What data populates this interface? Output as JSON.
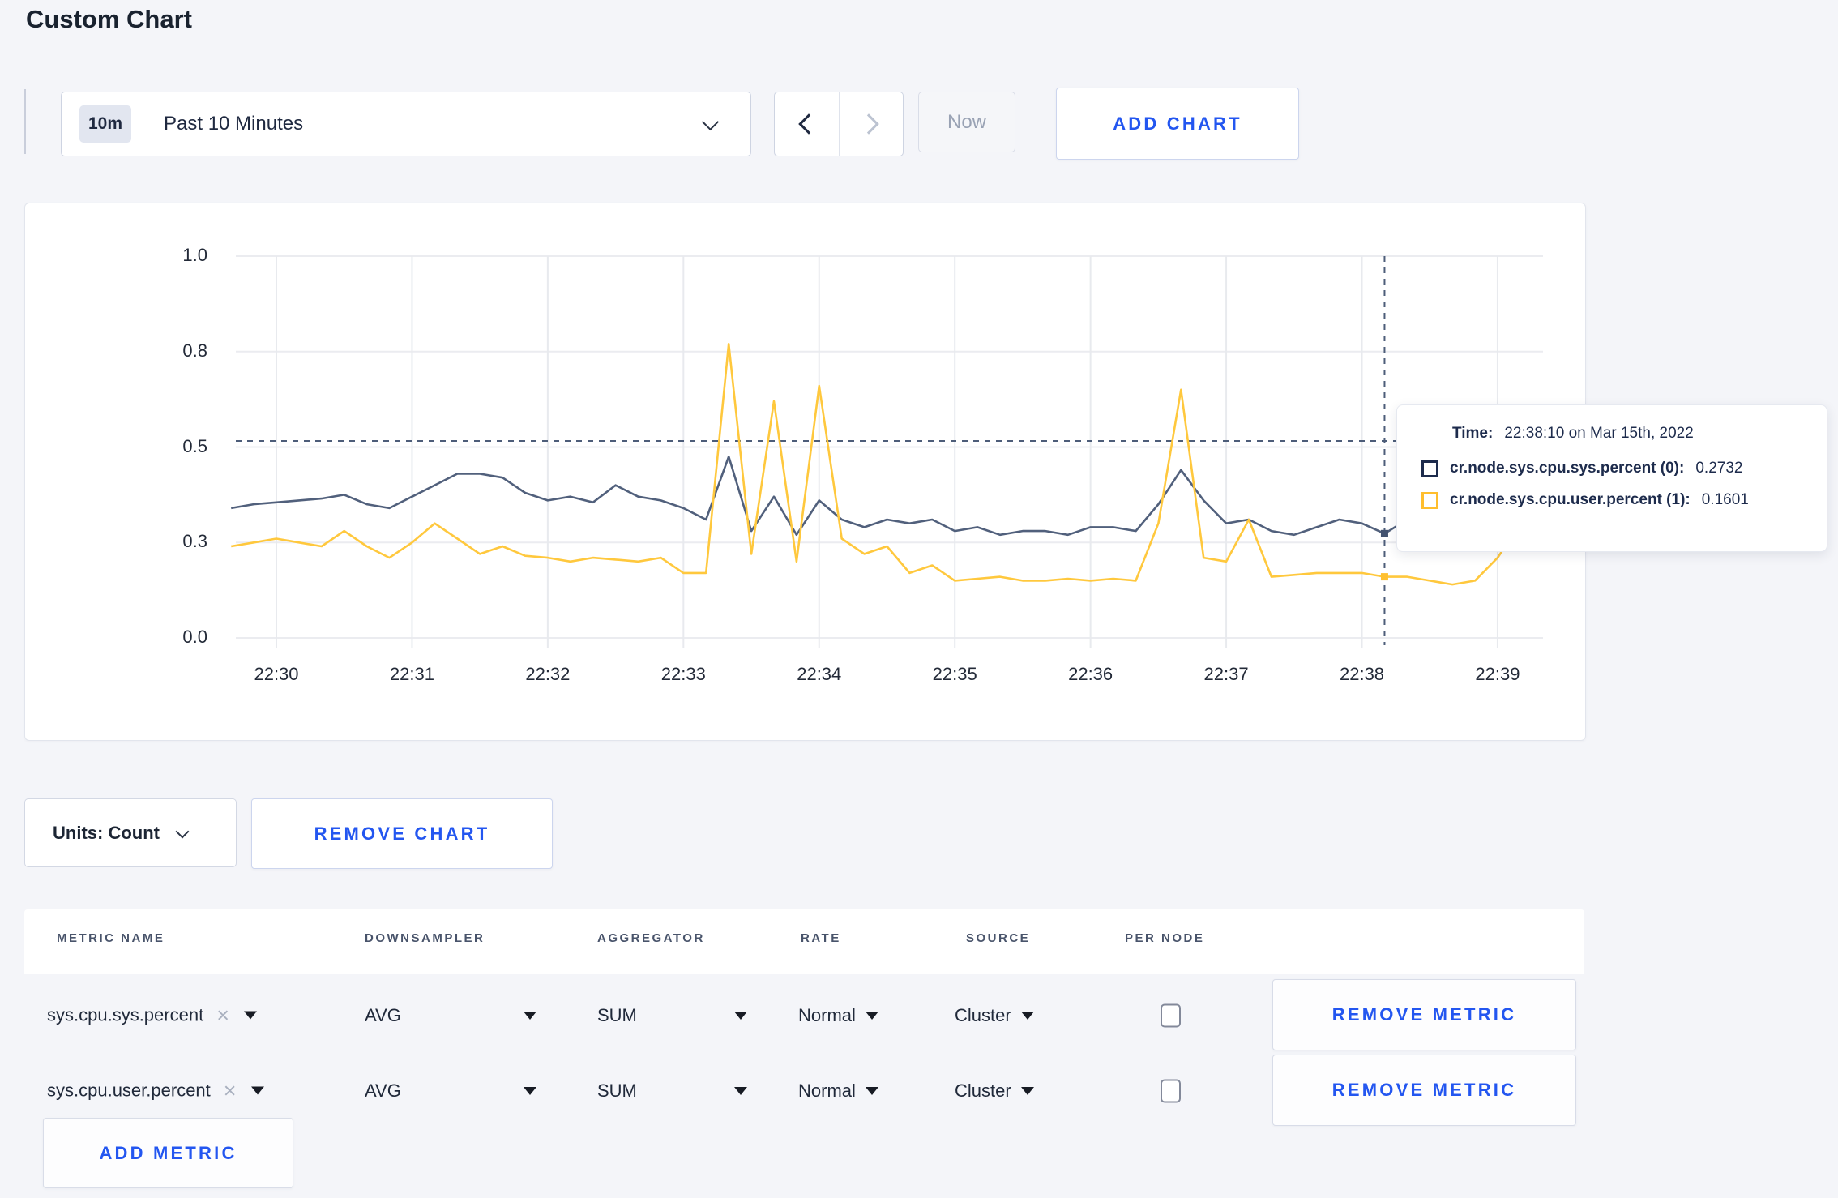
{
  "colors": {
    "accent_blue": "#2356f0",
    "series_sys": "#51607c",
    "series_user": "#ffc83d",
    "page_background": "#f4f5f9"
  },
  "page": {
    "title": "Custom Chart"
  },
  "toolbar": {
    "time_window_badge": "10m",
    "time_window_label": "Past 10 Minutes",
    "now_label": "Now",
    "add_chart_label": "ADD CHART"
  },
  "chart_data": {
    "type": "line",
    "title": "",
    "ylim": [
      0,
      1
    ],
    "grid": true,
    "legend_position": "tooltip",
    "y_ticks": [
      {
        "value": 0,
        "label": "0.0"
      },
      {
        "value": 0.25,
        "label": "0.3"
      },
      {
        "value": 0.5,
        "label": "0.5"
      },
      {
        "value": 0.75,
        "label": "0.8"
      },
      {
        "value": 1,
        "label": "1.0"
      }
    ],
    "x_ticks": [
      "22:30",
      "22:31",
      "22:32",
      "22:33",
      "22:34",
      "22:35",
      "22:36",
      "22:37",
      "22:38",
      "22:39"
    ],
    "x_start": "22:29:40",
    "x_step_seconds": 10,
    "series": [
      {
        "name": "cr.node.sys.cpu.sys.percent (0)",
        "color": "#51607c",
        "values": [
          0.34,
          0.35,
          0.355,
          0.36,
          0.365,
          0.375,
          0.35,
          0.34,
          0.37,
          0.4,
          0.43,
          0.43,
          0.42,
          0.38,
          0.36,
          0.37,
          0.355,
          0.4,
          0.37,
          0.36,
          0.34,
          0.31,
          0.475,
          0.28,
          0.37,
          0.27,
          0.36,
          0.31,
          0.29,
          0.31,
          0.3,
          0.31,
          0.28,
          0.29,
          0.27,
          0.28,
          0.28,
          0.27,
          0.29,
          0.29,
          0.28,
          0.35,
          0.44,
          0.36,
          0.3,
          0.31,
          0.28,
          0.27,
          0.29,
          0.31,
          0.3,
          0.2732,
          0.31,
          0.25,
          0.24,
          0.26,
          0.29,
          0.31,
          0.3
        ]
      },
      {
        "name": "cr.node.sys.cpu.user.percent (1)",
        "color": "#ffc83d",
        "values": [
          0.24,
          0.25,
          0.26,
          0.25,
          0.24,
          0.28,
          0.24,
          0.21,
          0.25,
          0.3,
          0.26,
          0.22,
          0.24,
          0.215,
          0.21,
          0.2,
          0.21,
          0.205,
          0.2,
          0.21,
          0.17,
          0.17,
          0.77,
          0.22,
          0.62,
          0.2,
          0.66,
          0.26,
          0.22,
          0.24,
          0.17,
          0.19,
          0.15,
          0.155,
          0.16,
          0.15,
          0.15,
          0.155,
          0.15,
          0.155,
          0.15,
          0.3,
          0.65,
          0.21,
          0.2,
          0.31,
          0.16,
          0.165,
          0.17,
          0.17,
          0.17,
          0.1601,
          0.16,
          0.15,
          0.14,
          0.15,
          0.21,
          0.3,
          0.26
        ]
      }
    ],
    "crosshair": {
      "index": 51,
      "time": "22:38:10",
      "hline_value": 0.516,
      "dot_values": [
        0.2732,
        0.1601
      ]
    },
    "tooltip": {
      "time_label": "Time:",
      "time_value": "22:38:10 on Mar 15th, 2022",
      "entries": [
        {
          "label": "cr.node.sys.cpu.sys.percent (0):",
          "value": "0.2732",
          "color": "#1d2b4c"
        },
        {
          "label": "cr.node.sys.cpu.user.percent (1):",
          "value": "0.1601",
          "color": "#ffbe2d"
        }
      ]
    }
  },
  "units": {
    "label": "Units: Count",
    "remove_chart_label": "REMOVE CHART"
  },
  "metrics_table": {
    "columns": [
      "METRIC NAME",
      "DOWNSAMPLER",
      "AGGREGATOR",
      "RATE",
      "SOURCE",
      "PER NODE"
    ],
    "rows": [
      {
        "metric": "sys.cpu.sys.percent",
        "downsampler": "AVG",
        "aggregator": "SUM",
        "rate": "Normal",
        "source": "Cluster",
        "per_node_checked": false,
        "remove_label": "REMOVE METRIC"
      },
      {
        "metric": "sys.cpu.user.percent",
        "downsampler": "AVG",
        "aggregator": "SUM",
        "rate": "Normal",
        "source": "Cluster",
        "per_node_checked": false,
        "remove_label": "REMOVE METRIC"
      }
    ],
    "add_metric_label": "ADD METRIC"
  },
  "icons": {
    "close": "×"
  }
}
